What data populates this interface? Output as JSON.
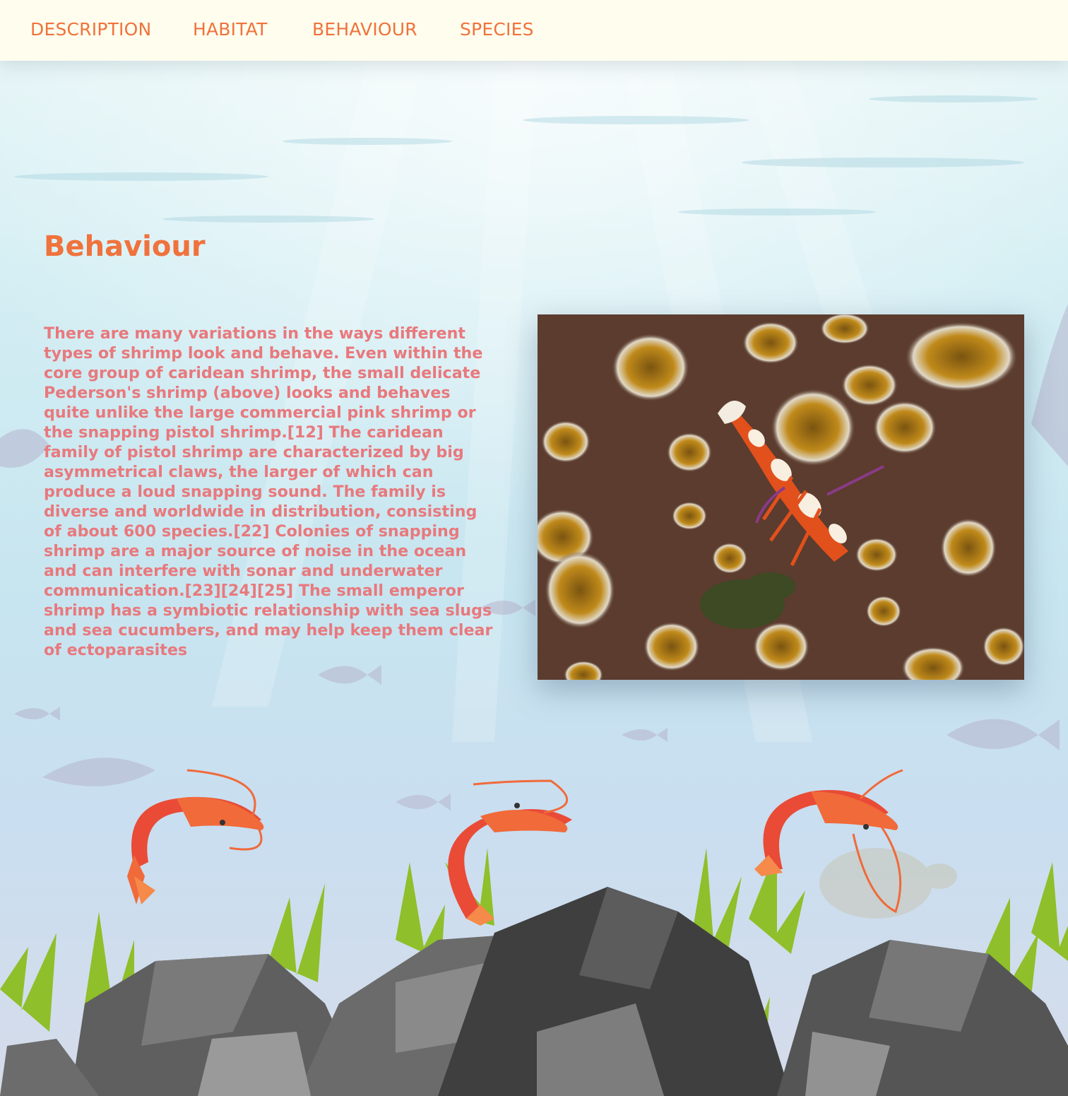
{
  "nav": {
    "items": [
      {
        "label": "DESCRIPTION"
      },
      {
        "label": "HABITAT"
      },
      {
        "label": "BEHAVIOUR"
      },
      {
        "label": "SPECIES"
      }
    ]
  },
  "section": {
    "title": "Behaviour",
    "body": "There are many variations in the ways different types of shrimp look and behave. Even within the core group of caridean shrimp, the small delicate Pederson's shrimp (above) looks and behaves quite unlike the large commercial pink shrimp or the snapping pistol shrimp.[12] The caridean family of pistol shrimp are characterized by big asymmetrical claws, the larger of which can produce a loud snapping sound. The family is diverse and worldwide in distribution, consisting of about 600 species.[22] Colonies of snapping shrimp are a major source of noise in the ocean and can interfere with sonar and underwater communication.[23][24][25] The small emperor shrimp has a symbiotic relationship with sea slugs and sea cucumbers, and may help keep them clear of ectoparasites"
  },
  "colors": {
    "accent": "#f0723c",
    "body_text": "#e8797d",
    "nav_bg": "#fffeee"
  },
  "icons": [
    "shrimp-icon",
    "rock-icon",
    "seaweed-icon",
    "fish-silhouette-icon"
  ]
}
